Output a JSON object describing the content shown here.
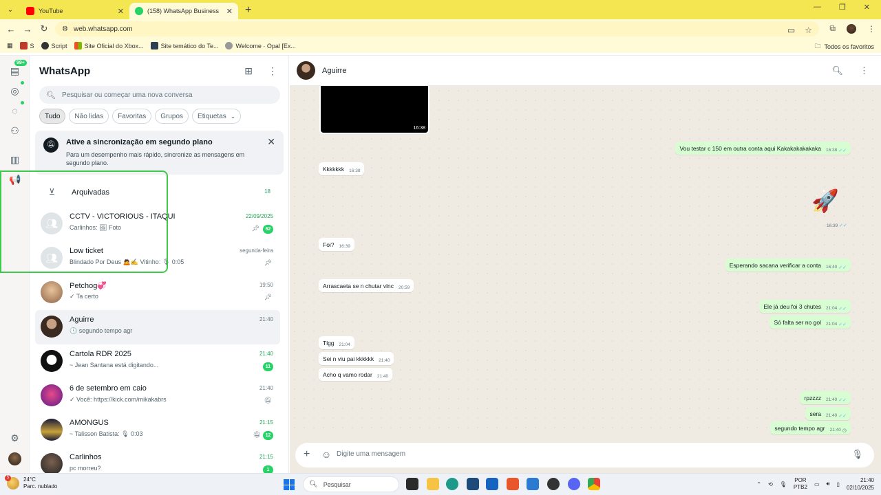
{
  "browser": {
    "tabs": [
      {
        "title": "YouTube",
        "color": "#ff0000"
      },
      {
        "title": "(158) WhatsApp Business",
        "color": "#25d366"
      }
    ],
    "url": "web.whatsapp.com",
    "bookmarks": [
      "S",
      "Script",
      "Site Oficial do Xbox...",
      "Site temático do Te...",
      "Welcome · Opal [Ex..."
    ],
    "bookmarks_right": "Todos os favoritos"
  },
  "rail": {
    "badge": "99+"
  },
  "sidebar": {
    "title": "WhatsApp",
    "search_placeholder": "Pesquisar ou começar uma nova conversa",
    "chips": [
      "Tudo",
      "Não lidas",
      "Favoritas",
      "Grupos",
      "Etiquetas"
    ],
    "sync": {
      "title": "Ative a sincronização em segundo plano",
      "desc": "Para um desempenho mais rápido, sincronize as mensagens em segundo plano."
    },
    "archived": {
      "label": "Arquivadas",
      "count": "18"
    },
    "chats": [
      {
        "name": "CCTV - VICTORIOUS - ITAQUI",
        "preview": "Carlinhos: 🖼 Foto",
        "time": "22/09/2025",
        "badge": "62"
      },
      {
        "name": "Low ticket",
        "preview": "Blindado Por Deus 🙇✍️ Vitinho: 🎙 0:05",
        "time": "segunda-feira"
      },
      {
        "name": "Petchog💞",
        "preview": "✓ Ta certo",
        "time": "19:50"
      },
      {
        "name": "Aguirre",
        "preview": "🕓 segundo tempo agr",
        "time": "21:40"
      },
      {
        "name": "Cartola RDR 2025",
        "preview": "~ Jean Santana está digitando...",
        "time": "21:40",
        "badge": "11"
      },
      {
        "name": "6 de setembro em caio",
        "preview": "✓ Você: https://kick.com/mikakabrs",
        "time": "21:40"
      },
      {
        "name": "AMONGUS",
        "preview": "~ Talisson Batista: 🎙 0:03",
        "time": "21:15",
        "badge": "12"
      },
      {
        "name": "Carlinhos",
        "preview": "pc morreu?",
        "time": "21:15",
        "badge": "1"
      }
    ]
  },
  "chat": {
    "contact": "Aguirre",
    "media_time": "16:38",
    "messages": [
      {
        "text": "Vou testar c 150 em outra conta aqui Kakakakakakaka",
        "time": "16:38"
      },
      {
        "text": "Kkkkkkk",
        "time": "16:38"
      },
      {
        "time": "16:39"
      },
      {
        "text": "Foi?",
        "time": "16:39"
      },
      {
        "text": "Esperando sacana verificar a conta",
        "time": "16:40"
      },
      {
        "text": "Arrascaeta se n chutar vlnc",
        "time": "20:59"
      },
      {
        "text": "Ele já deu foi 3 chutes",
        "time": "21:04"
      },
      {
        "text": "Só falta ser no gol",
        "time": "21:04"
      },
      {
        "text": "Tlgg",
        "time": "21:04"
      },
      {
        "text": "Sei n viu pai kkkkkk",
        "time": "21:40"
      },
      {
        "text": "Acho q vamo rodar",
        "time": "21:40"
      },
      {
        "text": "rpzzzz",
        "time": "21:40"
      },
      {
        "text": "sera",
        "time": "21:40"
      },
      {
        "text": "segundo tempo agr",
        "time": "21:40"
      }
    ],
    "composer_placeholder": "Digite uma mensagem"
  },
  "taskbar": {
    "weather_badge": "5",
    "temp": "24°C",
    "weather": "Parc. nublado",
    "search": "Pesquisar",
    "lang": "POR",
    "layout": "PTB2",
    "time": "21:40",
    "date": "02/10/2025"
  },
  "colors": {
    "accent": "#25d366",
    "outgoing_bubble": "#d9fdd3",
    "chat_bg": "#efeae2",
    "tab_bar": "#f4e651"
  }
}
